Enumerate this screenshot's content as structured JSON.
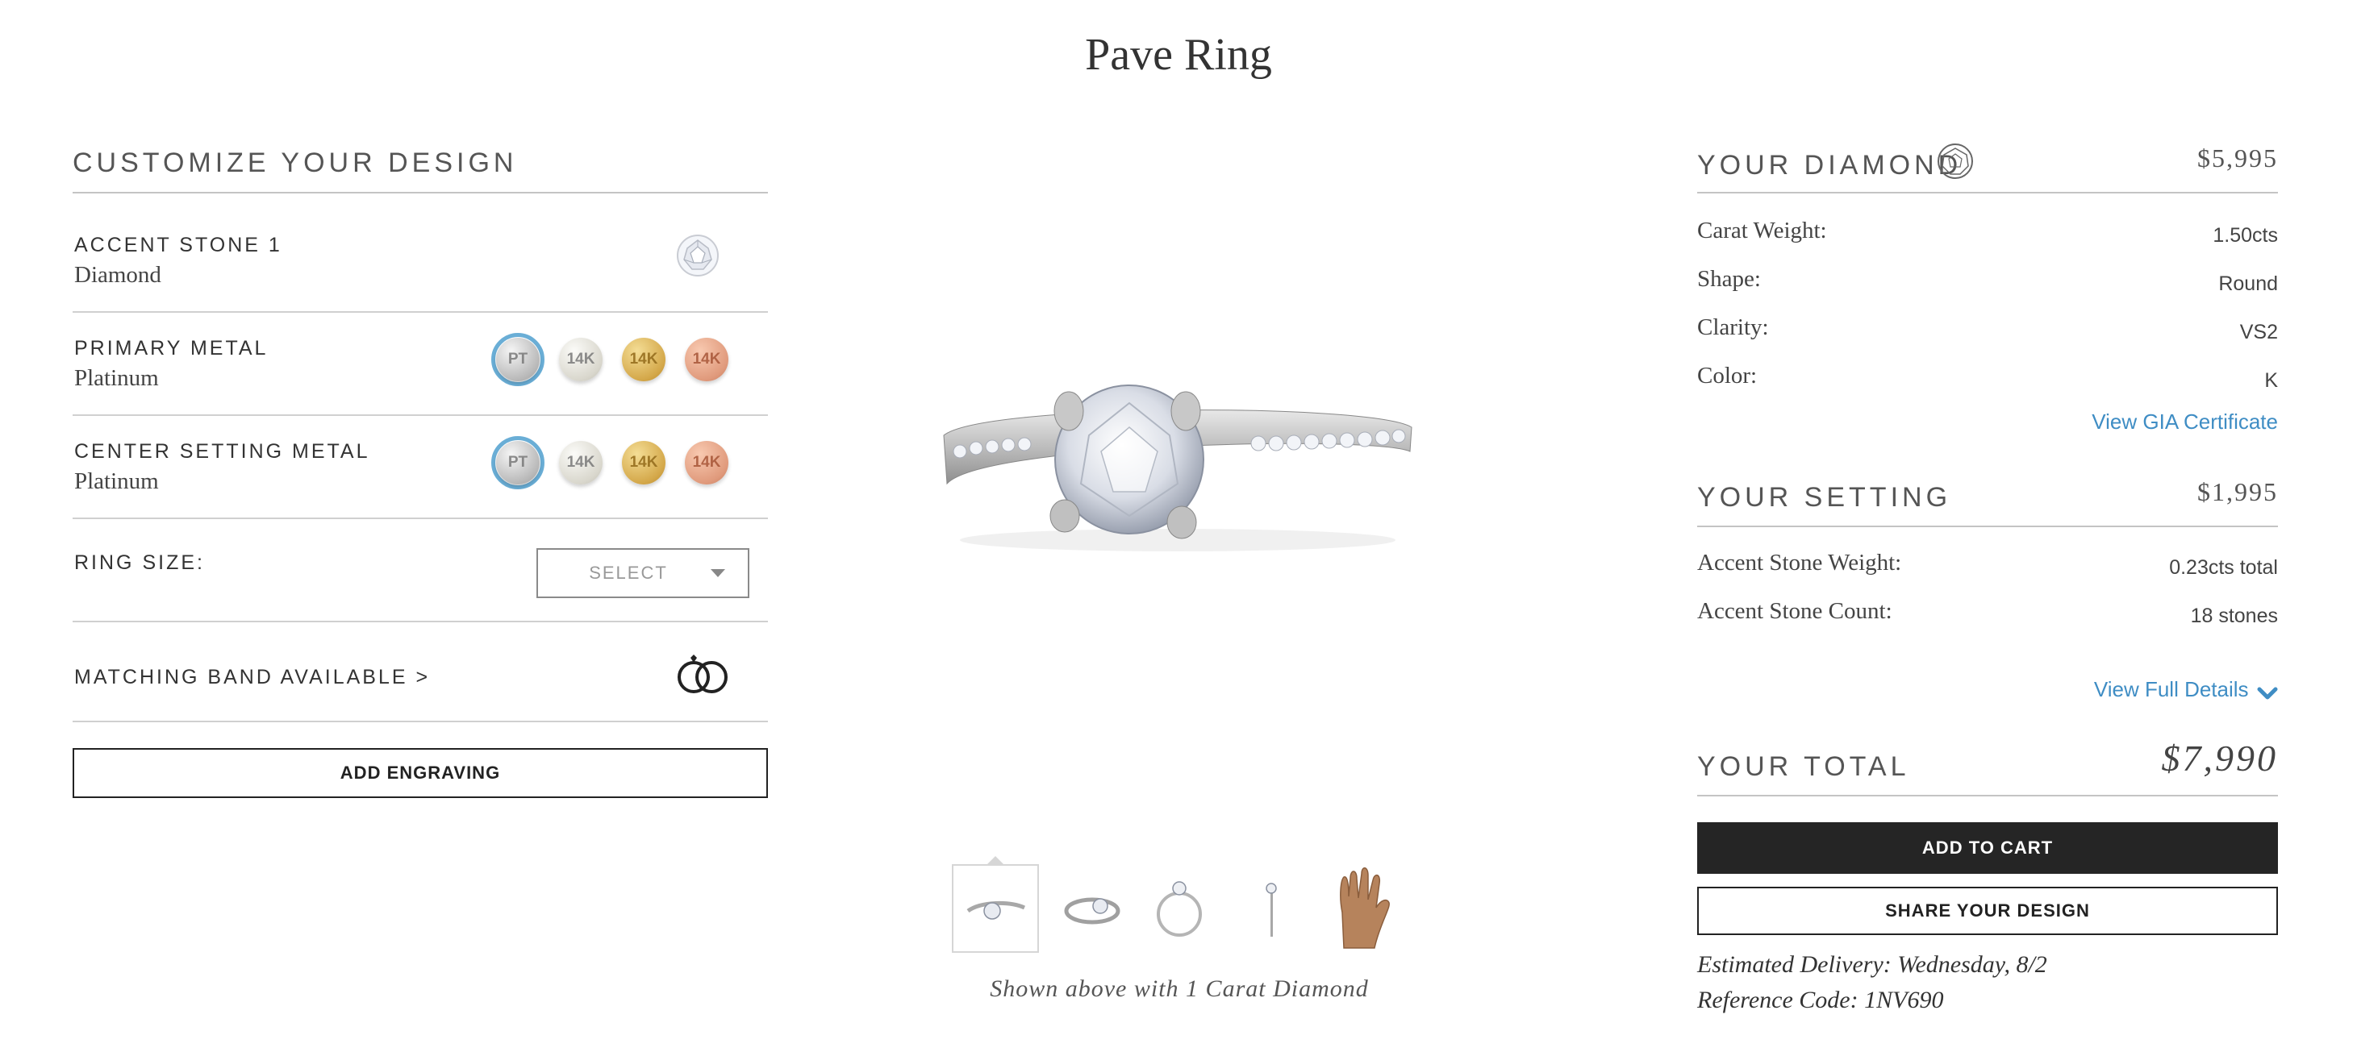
{
  "page": {
    "title": "Pave Ring"
  },
  "customize": {
    "heading": "CUSTOMIZE YOUR DESIGN",
    "options": [
      {
        "label": "ACCENT STONE 1",
        "value": "Diamond"
      },
      {
        "label": "PRIMARY METAL",
        "value": "Platinum"
      },
      {
        "label": "CENTER SETTING METAL",
        "value": "Platinum"
      }
    ],
    "metal_swatches": [
      "PT",
      "14K",
      "14K",
      "14K"
    ],
    "ring_size_label": "RING SIZE:",
    "ring_size_select": "SELECT",
    "matching_band": "MATCHING BAND AVAILABLE >",
    "add_engraving": "ADD ENGRAVING"
  },
  "product": {
    "caption": "Shown above with 1 Carat Diamond",
    "thumbnails": [
      "ring-angle-view",
      "ring-side-view",
      "ring-top-view",
      "ring-profile-view",
      "ring-on-hand-view"
    ]
  },
  "diamond": {
    "heading": "YOUR DIAMOND",
    "price": "$5,995",
    "specs": [
      {
        "label": "Carat Weight:",
        "value": "1.50cts"
      },
      {
        "label": "Shape:",
        "value": "Round"
      },
      {
        "label": "Clarity:",
        "value": "VS2"
      },
      {
        "label": "Color:",
        "value": "K"
      }
    ],
    "certificate_link": "View GIA Certificate"
  },
  "setting": {
    "heading": "YOUR SETTING",
    "price": "$1,995",
    "specs": [
      {
        "label": "Accent Stone Weight:",
        "value": "0.23cts total"
      },
      {
        "label": "Accent Stone Count:",
        "value": "18 stones"
      }
    ],
    "details_link": "View Full Details"
  },
  "total": {
    "heading": "YOUR TOTAL",
    "price": "$7,990",
    "add_to_cart": "ADD TO CART",
    "share": "SHARE YOUR DESIGN",
    "delivery": "Estimated Delivery: Wednesday, 8/2",
    "reference": "Reference Code: 1NV690"
  },
  "colors": {
    "accent_blue": "#3f8dc4",
    "selected_ring": "#6aaed6",
    "dark_button": "#252525"
  }
}
